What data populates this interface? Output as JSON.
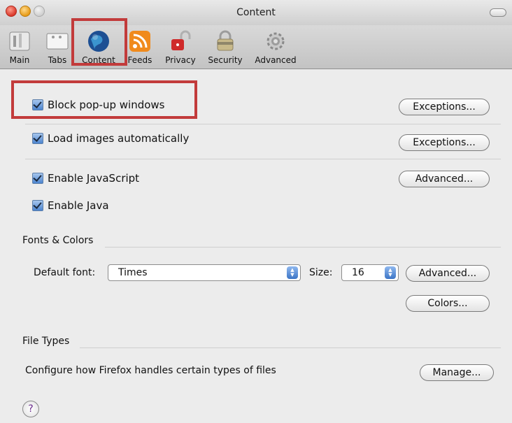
{
  "window": {
    "title": "Content"
  },
  "toolbar": {
    "items": [
      {
        "label": "Main",
        "icon": "switch-icon"
      },
      {
        "label": "Tabs",
        "icon": "tabs-icon"
      },
      {
        "label": "Content",
        "icon": "globe-icon"
      },
      {
        "label": "Feeds",
        "icon": "rss-icon"
      },
      {
        "label": "Privacy",
        "icon": "lock-icon"
      },
      {
        "label": "Security",
        "icon": "padlock-icon"
      },
      {
        "label": "Advanced",
        "icon": "gear-icon"
      }
    ],
    "selected": "Content"
  },
  "content": {
    "block_popups": {
      "label": "Block pop-up windows",
      "checked": true,
      "button": "Exceptions..."
    },
    "load_images": {
      "label": "Load images automatically",
      "checked": true,
      "button": "Exceptions..."
    },
    "enable_js": {
      "label": "Enable JavaScript",
      "checked": true,
      "button": "Advanced..."
    },
    "enable_java": {
      "label": "Enable Java",
      "checked": true
    }
  },
  "fonts_colors": {
    "section_title": "Fonts & Colors",
    "default_font_label": "Default font:",
    "default_font_value": "Times",
    "size_label": "Size:",
    "size_value": "16",
    "advanced_button": "Advanced...",
    "colors_button": "Colors..."
  },
  "file_types": {
    "section_title": "File Types",
    "description": "Configure how Firefox handles certain types of files",
    "manage_button": "Manage..."
  },
  "help": {
    "label": "?"
  },
  "colors": {
    "highlight": "#c23b3b",
    "checkbox_blue": "#4b84cf"
  }
}
